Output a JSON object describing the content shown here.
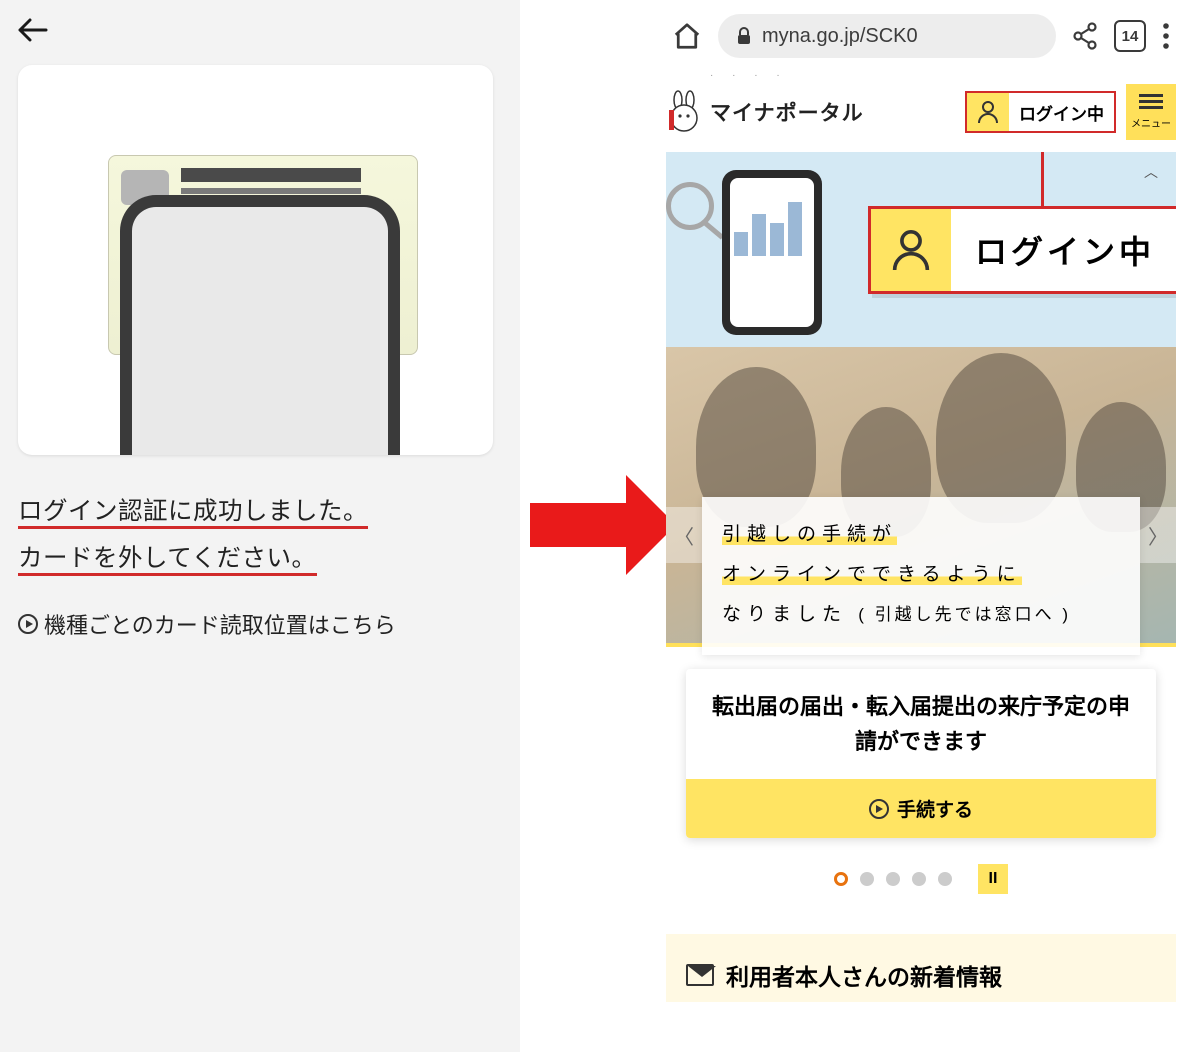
{
  "left": {
    "success_line1": "ログイン認証に成功しました。",
    "success_line2": "カードを外してください。",
    "readpos_link": "機種ごとのカード読取位置はこちら"
  },
  "browser": {
    "url": "myna.go.jp/SCK0",
    "tab_count": "14"
  },
  "header": {
    "site_name": "マイナポータル",
    "login_status_small": "ログイン中",
    "menu_label": "メニュー",
    "login_status_big": "ログイン中"
  },
  "banner": {
    "line1": "引越しの手続が",
    "line2": "オンラインでできるように",
    "line3_a": "なりました",
    "line3_b": "( 引越し先では窓口へ )"
  },
  "card": {
    "title": "転出届の届出・転入届提出の来庁予定の申請ができます",
    "action": "手続する"
  },
  "pager": {
    "pause": "II"
  },
  "news": {
    "heading": "利用者本人さんの新着情報"
  }
}
